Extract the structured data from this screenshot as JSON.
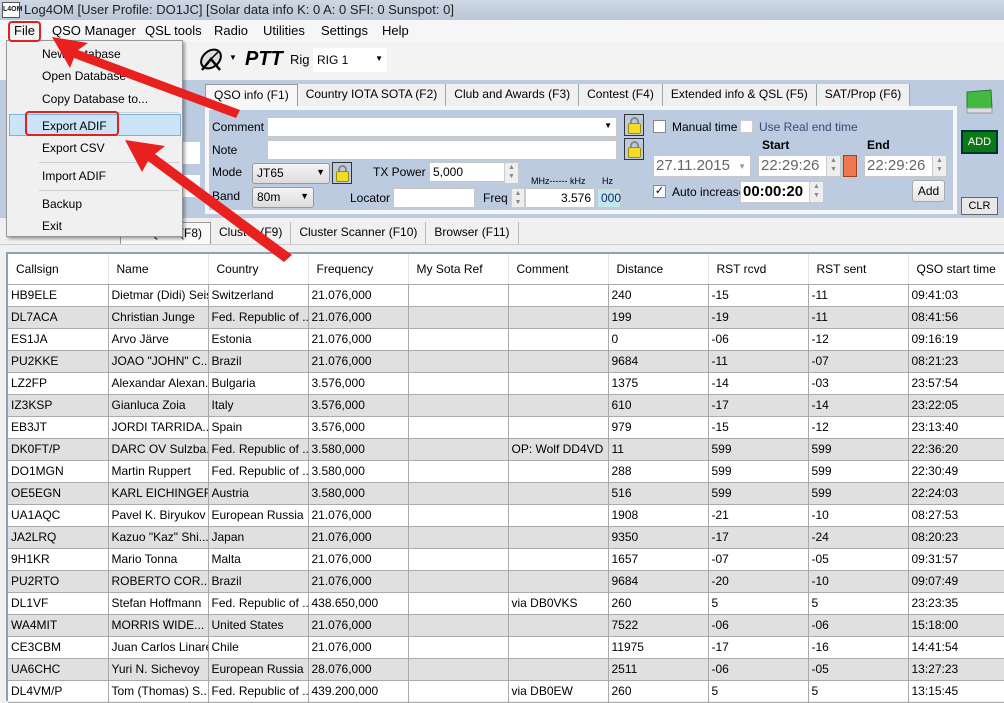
{
  "window": {
    "title": "Log4OM [User Profile: DO1JC] [Solar data info K: 0 A: 0 SFI: 0 Sunspot: 0]",
    "logo": "Log4OM"
  },
  "menu": [
    "File",
    "QSO Manager",
    "QSL tools",
    "Radio",
    "Utilities",
    "Settings",
    "Help"
  ],
  "file_menu": {
    "items": [
      "New Database",
      "Open Database",
      "Copy Database to...",
      "Export ADIF",
      "Export CSV",
      "Import ADIF",
      "Backup",
      "Exit"
    ],
    "highlighted": "Export ADIF"
  },
  "toolbar": {
    "ptt": "PTT",
    "rig_label": "Rig",
    "rig_value": "RIG 1",
    "icons": [
      "satellite-dish-icon"
    ]
  },
  "top_tabs": [
    "QSO info (F1)",
    "Country IOTA SOTA (F2)",
    "Club and Awards (F3)",
    "Contest (F4)",
    "Extended info & QSL (F5)",
    "SAT/Prop (F6)"
  ],
  "qso": {
    "comment_label": "Comment",
    "comment_value": "",
    "note_label": "Note",
    "note_value": "",
    "mode_label": "Mode",
    "mode_value": "JT65",
    "band_label": "Band",
    "band_value": "80m",
    "txpower_label": "TX Power",
    "txpower_value": "5,000",
    "locator_label": "Locator",
    "locator_value": "",
    "freq_label": "Freq",
    "freq_units": "MHz------ kHz",
    "hz_units": "Hz",
    "freq_value": "3.576",
    "hz_value": "000",
    "manual_time_label": "Manual time",
    "manual_time": false,
    "real_end_label": "Use Real end time",
    "real_end": false,
    "start_label": "Start",
    "end_label": "End",
    "date_value": "27.11.2015",
    "start_value": "22:29:26",
    "end_value": "22:29:26",
    "auto_increase_label": "Auto increase",
    "auto_increase": true,
    "increment_value": "00:00:20",
    "add_label": "Add",
    "add_big_label": "ADD",
    "clr_label": "CLR",
    "check": "✓"
  },
  "colors": {
    "panel": "#bccbe0",
    "add_green": "#0a7a14",
    "start_indicator": "#f07850",
    "highlight_red": "#e32020"
  },
  "bottom_tabs": [
    "QSO (F8)",
    "Cluster (F9)",
    "Cluster Scanner (F10)",
    "Browser (F11)"
  ],
  "table": {
    "columns": [
      "Callsign",
      "Name",
      "Country",
      "Frequency",
      "My Sota Ref",
      "Comment",
      "Distance",
      "RST rcvd",
      "RST sent",
      "QSO start time"
    ],
    "rows": [
      [
        "HB9ELE",
        "Dietmar (Didi) Seiss",
        "Switzerland",
        "21.076,000",
        "",
        "",
        "240",
        "-15",
        "-11",
        "09:41:03"
      ],
      [
        "DL7ACA",
        "Christian Junge",
        "Fed. Republic of ...",
        "21.076,000",
        "",
        "",
        "199",
        "-19",
        "-11",
        "08:41:56"
      ],
      [
        "ES1JA",
        "Arvo Järve",
        "Estonia",
        "21.076,000",
        "",
        "",
        "0",
        "-06",
        "-12",
        "09:16:19"
      ],
      [
        "PU2KKE",
        "JOAO \"JOHN\" C...",
        "Brazil",
        "21.076,000",
        "",
        "",
        "9684",
        "-11",
        "-07",
        "08:21:23"
      ],
      [
        "LZ2FP",
        "Alexandar Alexan...",
        "Bulgaria",
        "3.576,000",
        "",
        "",
        "1375",
        "-14",
        "-03",
        "23:57:54"
      ],
      [
        "IZ3KSP",
        "Gianluca Zoia",
        "Italy",
        "3.576,000",
        "",
        "",
        "610",
        "-17",
        "-14",
        "23:22:05"
      ],
      [
        "EB3JT",
        "JORDI TARRIDA...",
        "Spain",
        "3.576,000",
        "",
        "",
        "979",
        "-15",
        "-12",
        "23:13:40"
      ],
      [
        "DK0FT/P",
        "DARC OV Sulzba...",
        "Fed. Republic of ...",
        "3.580,000",
        "",
        "OP: Wolf DD4VD",
        "11",
        "599",
        "599",
        "22:36:20"
      ],
      [
        "DO1MGN",
        "Martin Ruppert",
        "Fed. Republic of ...",
        "3.580,000",
        "",
        "",
        "288",
        "599",
        "599",
        "22:30:49"
      ],
      [
        "OE5EGN",
        "KARL EICHINGER",
        "Austria",
        "3.580,000",
        "",
        "",
        "516",
        "599",
        "599",
        "22:24:03"
      ],
      [
        "UA1AQC",
        "Pavel K. Biryukov",
        "European Russia",
        "21.076,000",
        "",
        "",
        "1908",
        "-21",
        "-10",
        "08:27:53"
      ],
      [
        "JA2LRQ",
        "Kazuo \"Kaz\" Shi...",
        "Japan",
        "21.076,000",
        "",
        "",
        "9350",
        "-17",
        "-24",
        "08:20:23"
      ],
      [
        "9H1KR",
        "Mario Tonna",
        "Malta",
        "21.076,000",
        "",
        "",
        "1657",
        "-07",
        "-05",
        "09:31:57"
      ],
      [
        "PU2RTO",
        "ROBERTO COR...",
        "Brazil",
        "21.076,000",
        "",
        "",
        "9684",
        "-20",
        "-10",
        "09:07:49"
      ],
      [
        "DL1VF",
        "Stefan Hoffmann",
        "Fed. Republic of ...",
        "438.650,000",
        "",
        "via DB0VKS",
        "260",
        "5",
        "5",
        "23:23:35"
      ],
      [
        "WA4MIT",
        "MORRIS WIDE...",
        "United States",
        "21.076,000",
        "",
        "",
        "7522",
        "-06",
        "-06",
        "15:18:00"
      ],
      [
        "CE3CBM",
        "Juan Carlos Linares",
        "Chile",
        "21.076,000",
        "",
        "",
        "11975",
        "-17",
        "-16",
        "14:41:54"
      ],
      [
        "UA6CHC",
        "Yuri N. Sichevoy",
        "European Russia",
        "28.076,000",
        "",
        "",
        "2511",
        "-06",
        "-05",
        "13:27:23"
      ],
      [
        "DL4VM/P",
        "Tom (Thomas) S...",
        "Fed. Republic of ...",
        "439.200,000",
        "",
        "via DB0EW",
        "260",
        "5",
        "5",
        "13:15:45"
      ]
    ]
  }
}
